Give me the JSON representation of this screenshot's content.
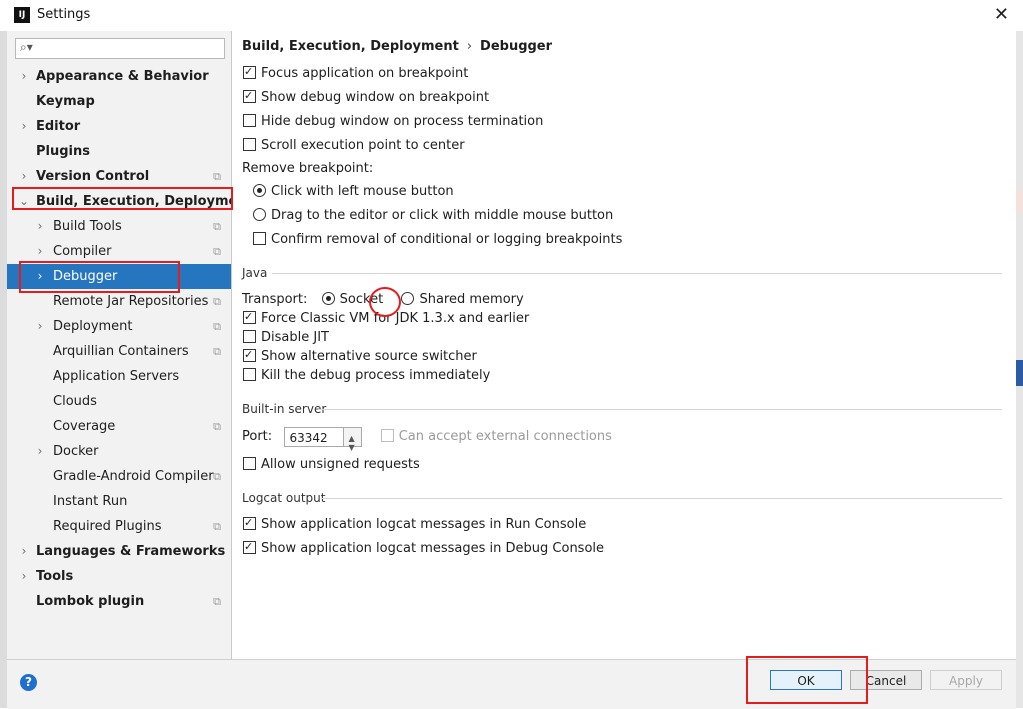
{
  "window": {
    "app_icon": "IJ",
    "title": "Settings",
    "close_icon": "✕"
  },
  "search": {
    "placeholder": "",
    "icon": "⌕▾"
  },
  "sidebar": {
    "items": [
      {
        "label": "Appearance & Behavior",
        "level": 1,
        "arrow": "›",
        "proj": false
      },
      {
        "label": "Keymap",
        "level": 1,
        "arrow": "",
        "proj": false
      },
      {
        "label": "Editor",
        "level": 1,
        "arrow": "›",
        "proj": false
      },
      {
        "label": "Plugins",
        "level": 1,
        "arrow": "",
        "proj": false
      },
      {
        "label": "Version Control",
        "level": 1,
        "arrow": "›",
        "proj": true
      },
      {
        "label": "Build, Execution, Deployment",
        "level": 1,
        "arrow": "⌄",
        "proj": false
      },
      {
        "label": "Build Tools",
        "level": 2,
        "arrow": "›",
        "proj": true
      },
      {
        "label": "Compiler",
        "level": 2,
        "arrow": "›",
        "proj": true
      },
      {
        "label": "Debugger",
        "level": 2,
        "arrow": "›",
        "proj": false,
        "selected": true
      },
      {
        "label": "Remote Jar Repositories",
        "level": 2,
        "arrow": "",
        "proj": true
      },
      {
        "label": "Deployment",
        "level": 2,
        "arrow": "›",
        "proj": true
      },
      {
        "label": "Arquillian Containers",
        "level": 2,
        "arrow": "",
        "proj": true
      },
      {
        "label": "Application Servers",
        "level": 2,
        "arrow": "",
        "proj": false
      },
      {
        "label": "Clouds",
        "level": 2,
        "arrow": "",
        "proj": false
      },
      {
        "label": "Coverage",
        "level": 2,
        "arrow": "",
        "proj": true
      },
      {
        "label": "Docker",
        "level": 2,
        "arrow": "›",
        "proj": false
      },
      {
        "label": "Gradle-Android Compiler",
        "level": 2,
        "arrow": "",
        "proj": true
      },
      {
        "label": "Instant Run",
        "level": 2,
        "arrow": "",
        "proj": false
      },
      {
        "label": "Required Plugins",
        "level": 2,
        "arrow": "",
        "proj": true
      },
      {
        "label": "Languages & Frameworks",
        "level": 1,
        "arrow": "›",
        "proj": false
      },
      {
        "label": "Tools",
        "level": 1,
        "arrow": "›",
        "proj": false
      },
      {
        "label": "Lombok plugin",
        "level": 1,
        "arrow": "",
        "proj": true
      }
    ],
    "proj_icon": "⧉"
  },
  "breadcrumb": {
    "part1": "Build, Execution, Deployment",
    "sep": "›",
    "part2": "Debugger"
  },
  "options": {
    "focus_app": {
      "label": "Focus application on breakpoint",
      "checked": true
    },
    "show_debug": {
      "label": "Show debug window on breakpoint",
      "checked": true
    },
    "hide_debug": {
      "label": "Hide debug window on process termination",
      "checked": false
    },
    "scroll_exec": {
      "label": "Scroll execution point to center",
      "checked": false
    },
    "remove_bp_label": "Remove breakpoint:",
    "click_left": {
      "label": "Click with left mouse button",
      "checked": true
    },
    "drag_editor": {
      "label": "Drag to the editor or click with middle mouse button",
      "checked": false
    },
    "confirm_removal": {
      "label": "Confirm removal of conditional or logging breakpoints",
      "checked": false
    }
  },
  "java": {
    "section": "Java",
    "transport_label": "Transport:",
    "socket": {
      "label": "Socket",
      "checked": true
    },
    "shared_memory": {
      "label": "Shared memory",
      "checked": false
    },
    "force_classic": {
      "label": "Force Classic VM for JDK 1.3.x and earlier",
      "checked": true
    },
    "disable_jit": {
      "label": "Disable JIT",
      "checked": false
    },
    "alt_source": {
      "label": "Show alternative source switcher",
      "checked": true
    },
    "kill_debug": {
      "label": "Kill the debug process immediately",
      "checked": false
    }
  },
  "builtin": {
    "section": "Built-in server",
    "port_label": "Port:",
    "port_value": "63342",
    "external": {
      "label": "Can accept external connections",
      "checked": false
    },
    "unsigned": {
      "label": "Allow unsigned requests",
      "checked": false
    }
  },
  "logcat": {
    "section": "Logcat output",
    "run_console": {
      "label": "Show application logcat messages in Run Console",
      "checked": true
    },
    "debug_console": {
      "label": "Show application logcat messages in Debug Console",
      "checked": true
    }
  },
  "footer": {
    "help": "?",
    "ok": "OK",
    "cancel": "Cancel",
    "apply": "Apply"
  },
  "colors": {
    "selection": "#2675bf",
    "annotation": "#e31d1d",
    "default_button": "#2a77c9"
  }
}
